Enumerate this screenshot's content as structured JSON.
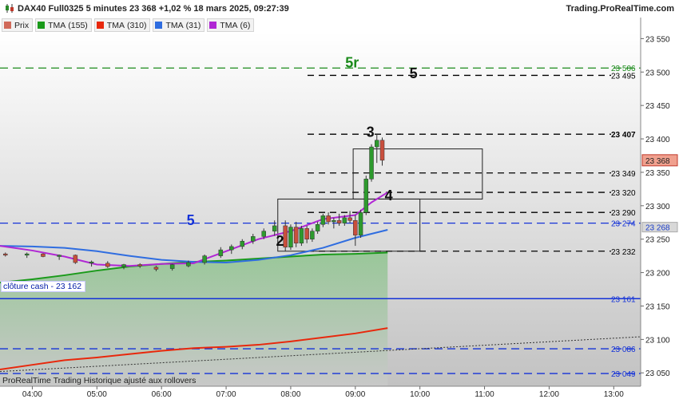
{
  "header": {
    "title": "DAX40 Full0325 5 minutes 23 368 +1,02 % 18 mars 2025, 09:27:39",
    "site": "Trading.ProRealTime.com"
  },
  "legend": [
    {
      "label": "Prix",
      "period": "",
      "color": "#d06a5a"
    },
    {
      "label": "TMA",
      "period": "(155)",
      "color": "#1a9a1a"
    },
    {
      "label": "TMA",
      "period": "(310)",
      "color": "#e8280c"
    },
    {
      "label": "TMA",
      "period": "(31)",
      "color": "#2f6de0"
    },
    {
      "label": "TMA",
      "period": "(6)",
      "color": "#b026d4"
    }
  ],
  "footer": "ProRealTime Trading  Historique ajusté aux rollovers",
  "chart_data": {
    "type": "candlestick",
    "y_range": [
      23030,
      23560
    ],
    "y_ticks": [
      {
        "v": 23550,
        "t": "23 550"
      },
      {
        "v": 23500,
        "t": "23 500"
      },
      {
        "v": 23450,
        "t": "23 450"
      },
      {
        "v": 23400,
        "t": "23 400"
      },
      {
        "v": 23350,
        "t": "23 350"
      },
      {
        "v": 23300,
        "t": "23 300"
      },
      {
        "v": 23250,
        "t": "23 250"
      },
      {
        "v": 23200,
        "t": "23 200"
      },
      {
        "v": 23150,
        "t": "23 150"
      },
      {
        "v": 23100,
        "t": "23 100"
      },
      {
        "v": 23050,
        "t": "23 050"
      }
    ],
    "x_range": [
      "03:30",
      "13:25"
    ],
    "x_ticks": [
      "04:00",
      "05:00",
      "06:00",
      "07:00",
      "08:00",
      "09:00",
      "10:00",
      "11:00",
      "12:00",
      "13:00"
    ],
    "last_price": {
      "value": 23368,
      "text": "23 368"
    },
    "horizontal_levels": [
      {
        "value": 23506,
        "text": "23 506",
        "color": "#1a8a1a",
        "style": "long-dash",
        "extent": "full"
      },
      {
        "value": 23495,
        "text": "23 495",
        "color": "#000000",
        "style": "dash",
        "extent": "right"
      },
      {
        "value": 23407,
        "text": "23 407",
        "color": "#000000",
        "style": "dash",
        "extent": "right",
        "bold": true
      },
      {
        "value": 23349,
        "text": "23 349",
        "color": "#000000",
        "style": "dash",
        "extent": "right"
      },
      {
        "value": 23320,
        "text": "23 320",
        "color": "#000000",
        "style": "dash",
        "extent": "right"
      },
      {
        "value": 23290,
        "text": "23 290",
        "color": "#000000",
        "style": "dash",
        "extent": "right"
      },
      {
        "value": 23274,
        "text": "23 274",
        "color": "#1432d8",
        "style": "long-dash",
        "extent": "full"
      },
      {
        "value": 23268,
        "text": "23 268",
        "color": "#1a3cc8",
        "style": "none",
        "extent": "label"
      },
      {
        "value": 23232,
        "text": "23 232",
        "color": "#000000",
        "style": "dash",
        "extent": "right"
      },
      {
        "value": 23161,
        "text": "23 161",
        "color": "#1432d8",
        "style": "solid",
        "extent": "full"
      },
      {
        "value": 23086,
        "text": "23 086",
        "color": "#1432d8",
        "style": "long-dash",
        "extent": "full"
      },
      {
        "value": 23049,
        "text": "23 049",
        "color": "#1432d8",
        "style": "long-dash",
        "extent": "full"
      }
    ],
    "cash_close": {
      "label": "clôture cash -  23 162",
      "value": 23162
    },
    "annotations": [
      {
        "text": "5r",
        "time": "08:57",
        "value": 23507,
        "color": "#1a8a1a"
      },
      {
        "text": "5",
        "time": "09:54",
        "value": 23491,
        "color": "#111111"
      },
      {
        "text": "3",
        "time": "09:14",
        "value": 23403,
        "color": "#111111"
      },
      {
        "text": "4",
        "time": "09:31",
        "value": 23308,
        "color": "#111111"
      },
      {
        "text": "5",
        "time": "06:27",
        "value": 23271,
        "color": "#1432d8"
      },
      {
        "text": "2",
        "time": "07:50",
        "value": 23240,
        "color": "#111111"
      }
    ],
    "boxes": [
      {
        "t0": "08:58",
        "t1": "10:58",
        "top": 23385,
        "bottom": 23310
      },
      {
        "t0": "07:48",
        "t1": "10:00",
        "top": 23310,
        "bottom": 23232
      }
    ],
    "tma_lines": [
      {
        "name": "TMA (155)",
        "color": "#1a9a1a",
        "fill": true,
        "points": [
          [
            "03:30",
            23185
          ],
          [
            "04:00",
            23190
          ],
          [
            "04:30",
            23196
          ],
          [
            "05:00",
            23203
          ],
          [
            "05:30",
            23209
          ],
          [
            "06:00",
            23213
          ],
          [
            "06:30",
            23216
          ],
          [
            "07:00",
            23218
          ],
          [
            "07:30",
            23221
          ],
          [
            "08:00",
            23224
          ],
          [
            "08:30",
            23227
          ],
          [
            "09:00",
            23228
          ],
          [
            "09:30",
            23230
          ]
        ]
      },
      {
        "name": "TMA (310)",
        "color": "#e8280c",
        "fill": false,
        "points": [
          [
            "03:30",
            23055
          ],
          [
            "04:00",
            23062
          ],
          [
            "04:30",
            23069
          ],
          [
            "05:00",
            23073
          ],
          [
            "05:30",
            23078
          ],
          [
            "06:00",
            23083
          ],
          [
            "06:30",
            23087
          ],
          [
            "07:00",
            23089
          ],
          [
            "07:30",
            23092
          ],
          [
            "08:00",
            23097
          ],
          [
            "08:30",
            23103
          ],
          [
            "09:00",
            23109
          ],
          [
            "09:30",
            23117
          ]
        ]
      },
      {
        "name": "TMA (31)",
        "color": "#2f6de0",
        "fill": false,
        "points": [
          [
            "03:30",
            23240
          ],
          [
            "04:00",
            23239
          ],
          [
            "04:30",
            23237
          ],
          [
            "05:00",
            23232
          ],
          [
            "05:30",
            23225
          ],
          [
            "06:00",
            23219
          ],
          [
            "06:30",
            23216
          ],
          [
            "07:00",
            23215
          ],
          [
            "07:30",
            23219
          ],
          [
            "08:00",
            23226
          ],
          [
            "08:30",
            23237
          ],
          [
            "09:00",
            23252
          ],
          [
            "09:30",
            23264
          ]
        ]
      },
      {
        "name": "TMA (6)",
        "color": "#b026d4",
        "fill": false,
        "points": [
          [
            "03:30",
            23240
          ],
          [
            "04:00",
            23233
          ],
          [
            "04:30",
            23224
          ],
          [
            "05:00",
            23212
          ],
          [
            "05:30",
            23210
          ],
          [
            "06:00",
            23213
          ],
          [
            "06:30",
            23214
          ],
          [
            "07:00",
            23232
          ],
          [
            "07:30",
            23250
          ],
          [
            "08:00",
            23262
          ],
          [
            "08:30",
            23280
          ],
          [
            "09:00",
            23286
          ],
          [
            "09:15",
            23305
          ],
          [
            "09:30",
            23320
          ]
        ]
      }
    ],
    "trend_line": {
      "t0": "03:30",
      "v0": 23052,
      "t1": "13:25",
      "v1": 23104,
      "color": "#333333"
    },
    "candles": [
      {
        "t": "03:35",
        "o": 23228,
        "h": 23230,
        "l": 23224,
        "c": 23226
      },
      {
        "t": "03:55",
        "o": 23226,
        "h": 23230,
        "l": 23222,
        "c": 23228
      },
      {
        "t": "04:10",
        "o": 23228,
        "h": 23229,
        "l": 23223,
        "c": 23224
      },
      {
        "t": "04:25",
        "o": 23224,
        "h": 23227,
        "l": 23219,
        "c": 23226
      },
      {
        "t": "04:40",
        "o": 23226,
        "h": 23227,
        "l": 23213,
        "c": 23215
      },
      {
        "t": "04:55",
        "o": 23215,
        "h": 23218,
        "l": 23209,
        "c": 23216
      },
      {
        "t": "05:10",
        "o": 23214,
        "h": 23217,
        "l": 23207,
        "c": 23209
      },
      {
        "t": "05:25",
        "o": 23209,
        "h": 23213,
        "l": 23205,
        "c": 23212
      },
      {
        "t": "05:40",
        "o": 23212,
        "h": 23214,
        "l": 23207,
        "c": 23210
      },
      {
        "t": "05:55",
        "o": 23208,
        "h": 23210,
        "l": 23202,
        "c": 23205
      },
      {
        "t": "06:10",
        "o": 23206,
        "h": 23213,
        "l": 23203,
        "c": 23212
      },
      {
        "t": "06:25",
        "o": 23210,
        "h": 23218,
        "l": 23208,
        "c": 23215
      },
      {
        "t": "06:40",
        "o": 23215,
        "h": 23227,
        "l": 23212,
        "c": 23225
      },
      {
        "t": "06:55",
        "o": 23225,
        "h": 23238,
        "l": 23222,
        "c": 23234
      },
      {
        "t": "07:05",
        "o": 23234,
        "h": 23242,
        "l": 23228,
        "c": 23239
      },
      {
        "t": "07:15",
        "o": 23239,
        "h": 23250,
        "l": 23235,
        "c": 23247
      },
      {
        "t": "07:25",
        "o": 23247,
        "h": 23258,
        "l": 23243,
        "c": 23254
      },
      {
        "t": "07:35",
        "o": 23254,
        "h": 23266,
        "l": 23250,
        "c": 23262
      },
      {
        "t": "07:45",
        "o": 23262,
        "h": 23278,
        "l": 23255,
        "c": 23270
      },
      {
        "t": "07:55",
        "o": 23270,
        "h": 23278,
        "l": 23232,
        "c": 23238
      },
      {
        "t": "08:00",
        "o": 23238,
        "h": 23272,
        "l": 23234,
        "c": 23268
      },
      {
        "t": "08:05",
        "o": 23268,
        "h": 23276,
        "l": 23238,
        "c": 23244
      },
      {
        "t": "08:10",
        "o": 23244,
        "h": 23270,
        "l": 23240,
        "c": 23266
      },
      {
        "t": "08:15",
        "o": 23266,
        "h": 23270,
        "l": 23244,
        "c": 23250
      },
      {
        "t": "08:20",
        "o": 23250,
        "h": 23266,
        "l": 23246,
        "c": 23262
      },
      {
        "t": "08:25",
        "o": 23262,
        "h": 23276,
        "l": 23258,
        "c": 23272
      },
      {
        "t": "08:30",
        "o": 23272,
        "h": 23288,
        "l": 23268,
        "c": 23285
      },
      {
        "t": "08:35",
        "o": 23285,
        "h": 23290,
        "l": 23272,
        "c": 23276
      },
      {
        "t": "08:40",
        "o": 23276,
        "h": 23282,
        "l": 23266,
        "c": 23278
      },
      {
        "t": "08:45",
        "o": 23278,
        "h": 23288,
        "l": 23270,
        "c": 23274
      },
      {
        "t": "08:50",
        "o": 23274,
        "h": 23286,
        "l": 23270,
        "c": 23282
      },
      {
        "t": "08:55",
        "o": 23282,
        "h": 23292,
        "l": 23274,
        "c": 23278
      },
      {
        "t": "09:00",
        "o": 23278,
        "h": 23286,
        "l": 23240,
        "c": 23256
      },
      {
        "t": "09:05",
        "o": 23256,
        "h": 23294,
        "l": 23252,
        "c": 23290
      },
      {
        "t": "09:10",
        "o": 23290,
        "h": 23345,
        "l": 23286,
        "c": 23340
      },
      {
        "t": "09:15",
        "o": 23340,
        "h": 23392,
        "l": 23336,
        "c": 23388
      },
      {
        "t": "09:20",
        "o": 23388,
        "h": 23408,
        "l": 23364,
        "c": 23398
      },
      {
        "t": "09:25",
        "o": 23398,
        "h": 23402,
        "l": 23360,
        "c": 23368
      }
    ]
  }
}
